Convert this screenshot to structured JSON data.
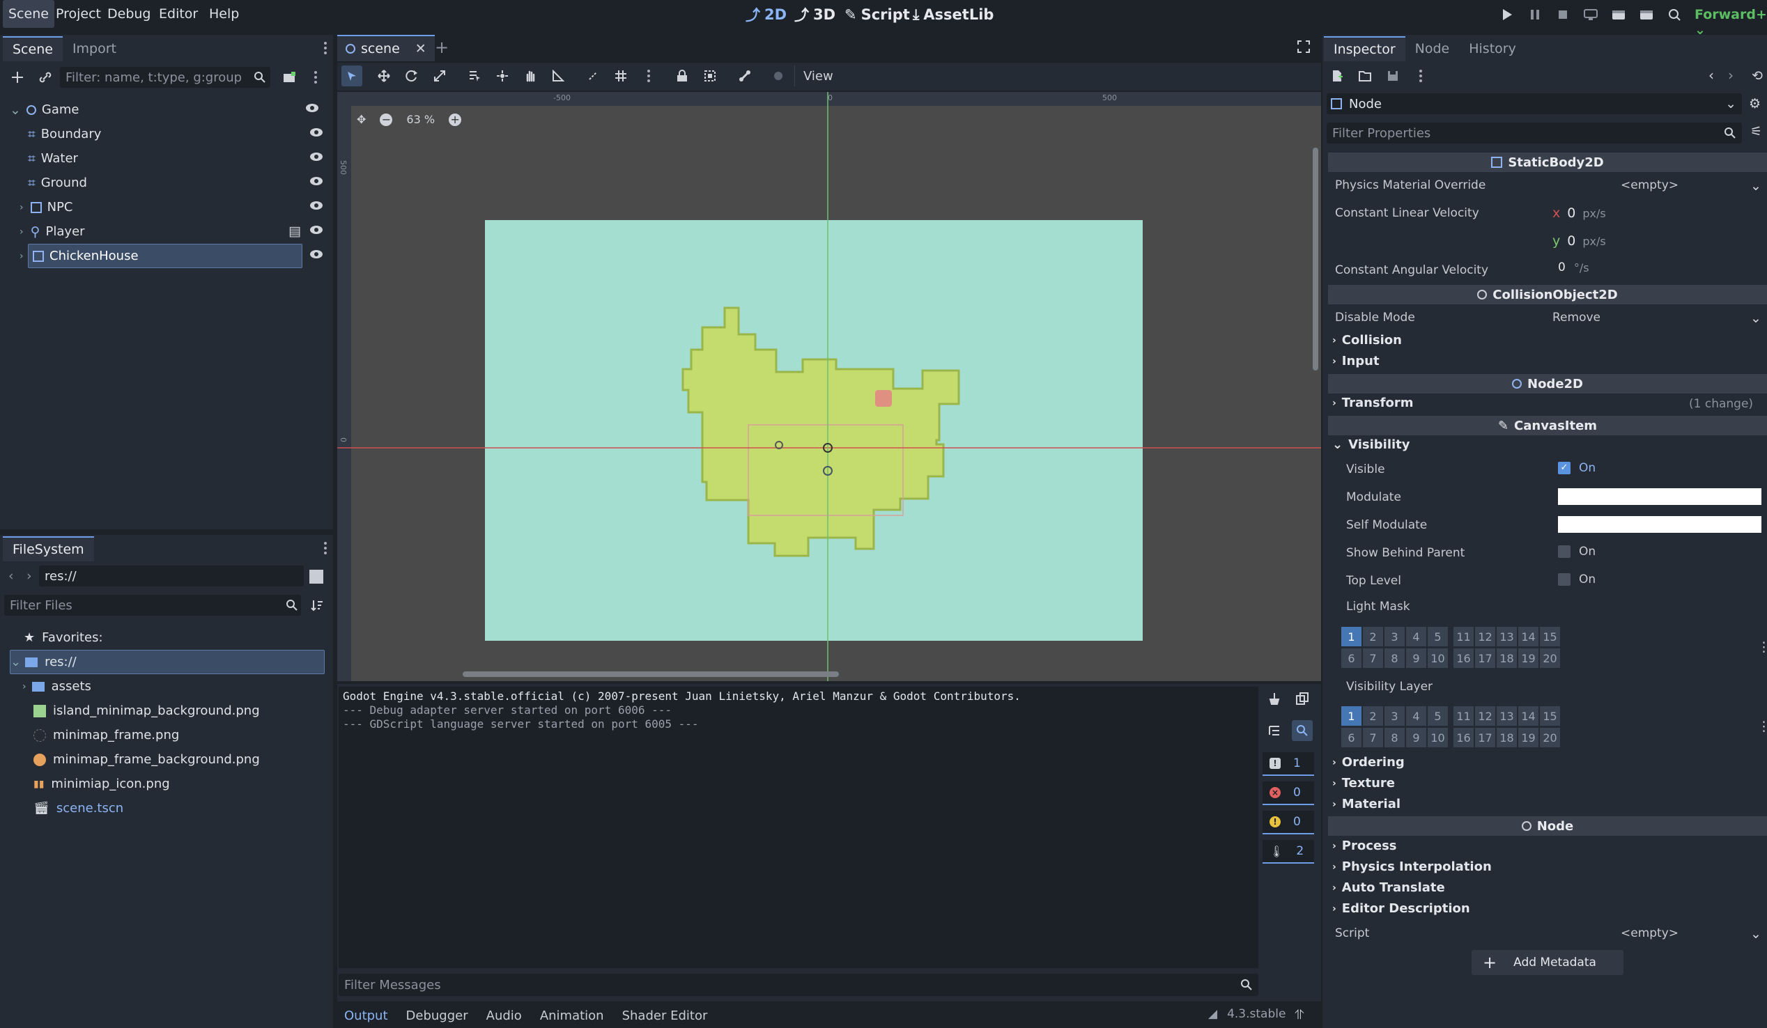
{
  "menu": [
    "Scene",
    "Project",
    "Debug",
    "Editor",
    "Help"
  ],
  "workspaces": [
    "2D",
    "3D",
    "Script",
    "AssetLib"
  ],
  "renderer": "Forward+",
  "scene_dock": {
    "tabs": [
      "Scene",
      "Import"
    ],
    "filter_placeholder": "Filter: name, t:type, g:group",
    "nodes": [
      {
        "name": "Game"
      },
      {
        "name": "Boundary"
      },
      {
        "name": "Water"
      },
      {
        "name": "Ground"
      },
      {
        "name": "NPC"
      },
      {
        "name": "Player"
      },
      {
        "name": "ChickenHouse"
      }
    ]
  },
  "filesystem": {
    "tab": "FileSystem",
    "path": "res://",
    "filter_placeholder": "Filter Files",
    "favorites": "Favorites:",
    "root": "res://",
    "items": [
      "assets",
      "island_minimap_background.png",
      "minimap_frame.png",
      "minimap_frame_background.png",
      "minimiap_icon.png",
      "scene.tscn"
    ]
  },
  "editor_tab": "scene",
  "viewport": {
    "view_menu": "View",
    "zoom": "63 %",
    "ruler": [
      "-500",
      "0",
      "500"
    ],
    "ruler_v": [
      "500",
      "0"
    ]
  },
  "output": {
    "lines": [
      "Godot Engine v4.3.stable.official (c) 2007-present Juan Linietsky, Ariel Manzur & Godot Contributors.",
      "--- Debug adapter server started on port 6006 ---",
      "--- GDScript language server started on port 6005 ---"
    ],
    "filter_placeholder": "Filter Messages",
    "counts": [
      "1",
      "0",
      "0",
      "2"
    ]
  },
  "bottom_tabs": [
    "Output",
    "Debugger",
    "Audio",
    "Animation",
    "Shader Editor"
  ],
  "version": "4.3.stable",
  "inspector": {
    "tabs": [
      "Inspector",
      "Node",
      "History"
    ],
    "node": "Node",
    "filter_placeholder": "Filter Properties",
    "static_body": "StaticBody2D",
    "pmo": "Physics Material Override",
    "empty": "<empty>",
    "clv": "Constant Linear Velocity",
    "clv_x": "0",
    "clv_y": "0",
    "unit_px": "px/s",
    "x": "x",
    "y": "y",
    "cav": "Constant Angular Velocity",
    "cav_val": "0",
    "unit_deg": "°/s",
    "collision_object": "CollisionObject2D",
    "disable_mode": "Disable Mode",
    "disable_val": "Remove",
    "collision": "Collision",
    "input": "Input",
    "node2d": "Node2D",
    "transform": "Transform",
    "changes": "(1 change)",
    "canvas_item": "CanvasItem",
    "visibility": "Visibility",
    "visible": "Visible",
    "on": "On",
    "modulate": "Modulate",
    "self_modulate": "Self Modulate",
    "show_behind": "Show Behind Parent",
    "top_level": "Top Level",
    "light_mask": "Light Mask",
    "visibility_layer": "Visibility Layer",
    "layers_row1": [
      "1",
      "2",
      "3",
      "4",
      "5",
      "11",
      "12",
      "13",
      "14",
      "15"
    ],
    "layers_row2": [
      "6",
      "7",
      "8",
      "9",
      "10",
      "16",
      "17",
      "18",
      "19",
      "20"
    ],
    "ordering": "Ordering",
    "texture": "Texture",
    "material": "Material",
    "process": "Process",
    "physics_interp": "Physics Interpolation",
    "auto_translate": "Auto Translate",
    "editor_desc": "Editor Description",
    "script": "Script",
    "add_metadata": "Add Metadata"
  },
  "colors": {
    "accent": "#6f9ee8",
    "water": "#a3ded0",
    "grass": "#c4dc6e",
    "selected": "#3b4d66"
  }
}
